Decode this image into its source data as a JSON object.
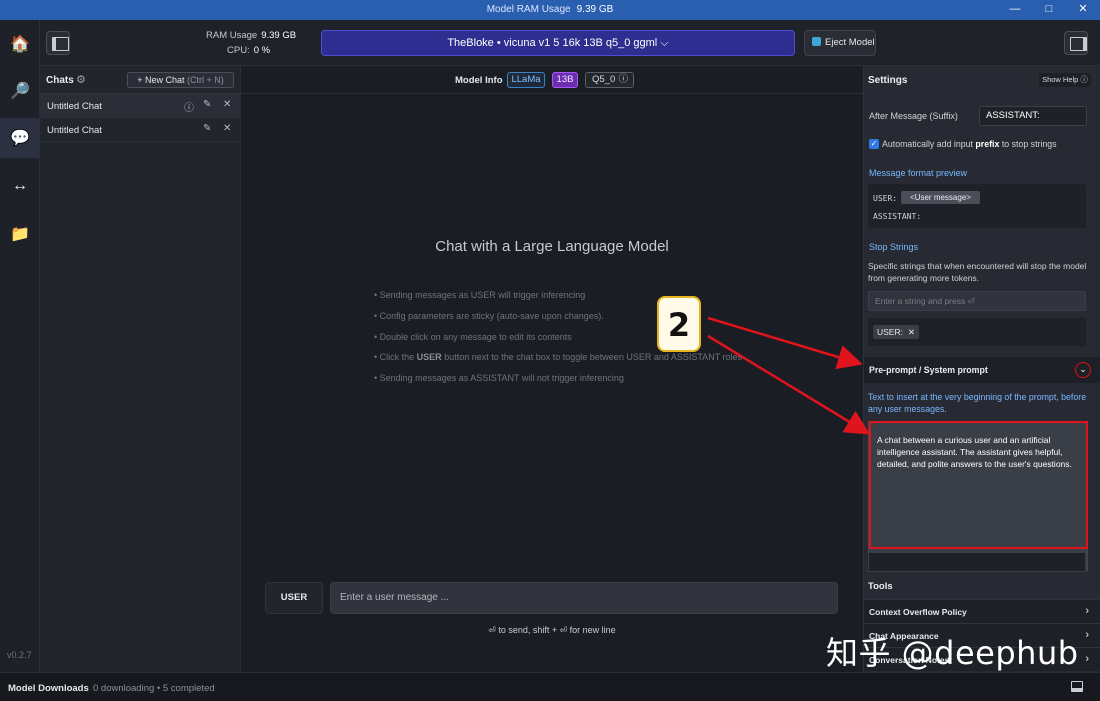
{
  "window": {
    "title_label": "Model RAM Usage",
    "title_value": "9.39 GB",
    "controls": {
      "minimize": "—",
      "maximize": "□",
      "close": "✕"
    }
  },
  "nav": {
    "items": [
      {
        "name": "home-icon",
        "glyph": "🏠"
      },
      {
        "name": "search-icon",
        "glyph": "🔎"
      },
      {
        "name": "chat-icon",
        "glyph": "💬"
      },
      {
        "name": "arrows-icon",
        "glyph": "↔"
      },
      {
        "name": "folder-icon",
        "glyph": "📁"
      }
    ],
    "version": "v0.2.7"
  },
  "topbar": {
    "ram_label": "RAM Usage",
    "ram_value": "9.39 GB",
    "cpu_label": "CPU:",
    "cpu_value": "0 %",
    "model_name": "TheBloke • vicuna v1 5 16k 13B q5_0 ggml ⌵",
    "eject_label": "Eject Model"
  },
  "chats": {
    "title": "Chats",
    "gear": "⚙",
    "new_chat": "+ New Chat",
    "new_chat_shortcut": "(Ctrl + N)",
    "items": [
      {
        "name": "Untitled Chat",
        "selected": true
      },
      {
        "name": "Untitled Chat",
        "selected": false
      }
    ],
    "icons": {
      "info": "ⓘ",
      "edit": "✎",
      "close": "✕"
    }
  },
  "center": {
    "info_label": "Model Info",
    "tag_arch": "LLaMa",
    "tag_size": "13B",
    "tag_quant": "Q5_0",
    "tag_quant_icon": "ⓘ",
    "heading": "Chat with a Large Language Model",
    "tips": [
      {
        "pre": "• Sending messages as USER will trigger inferencing",
        "bold": "",
        "post": ""
      },
      {
        "pre": "• Config parameters are sticky (auto-save upon changes).",
        "bold": "",
        "post": ""
      },
      {
        "pre": "• Double click on any message to edit its contents",
        "bold": "",
        "post": ""
      },
      {
        "pre": "• Click the ",
        "bold": "USER",
        "post": " button next to the chat box to toggle between USER and ASSISTANT roles"
      },
      {
        "pre": "• Sending messages as ASSISTANT will not trigger inferencing",
        "bold": "",
        "post": ""
      }
    ],
    "role_button": "USER",
    "input_placeholder": "Enter a user message ...",
    "send_hint": "⏎ to send, shift + ⏎ for new line"
  },
  "settings": {
    "title": "Settings",
    "show_help": "Show Help ⓘ",
    "suffix_label": "After Message (Suffix)",
    "suffix_value": "ASSISTANT:",
    "auto_prefix_pre": "Automatically add input ",
    "auto_prefix_bold": "prefix",
    "auto_prefix_post": " to stop strings",
    "auto_prefix_checked": true,
    "preview_title": "Message format preview",
    "preview_user": "USER:",
    "preview_user_chip": "<User message>",
    "preview_assistant": "ASSISTANT:",
    "stop_title": "Stop Strings",
    "stop_desc": "Specific strings that when encountered will stop the model from generating more tokens.",
    "stop_placeholder": "Enter a string and press ⏎",
    "stop_chip": "USER:",
    "stop_chip_remove": "✕",
    "preprompt_title": "Pre-prompt / System prompt",
    "preprompt_chevron": "⌄",
    "preprompt_desc": "Text to insert at the very beginning of the prompt, before any user messages.",
    "preprompt_text": "A chat between a curious user and an artificial intelligence assistant. The assistant gives helpful, detailed, and polite answers to the user's questions.",
    "tools_title": "Tools",
    "rows": [
      {
        "label": "Context Overflow Policy",
        "chevron": "›"
      },
      {
        "label": "Chat Appearance",
        "chevron": "›"
      },
      {
        "label": "Conversation Notes",
        "chevron": "›"
      }
    ]
  },
  "status": {
    "downloads_title": "Model Downloads",
    "downloads_status": "0 downloading • 5 completed"
  },
  "annotation": {
    "badge": "2",
    "watermark": "知乎 @deephub",
    "color": "#e0141d"
  }
}
